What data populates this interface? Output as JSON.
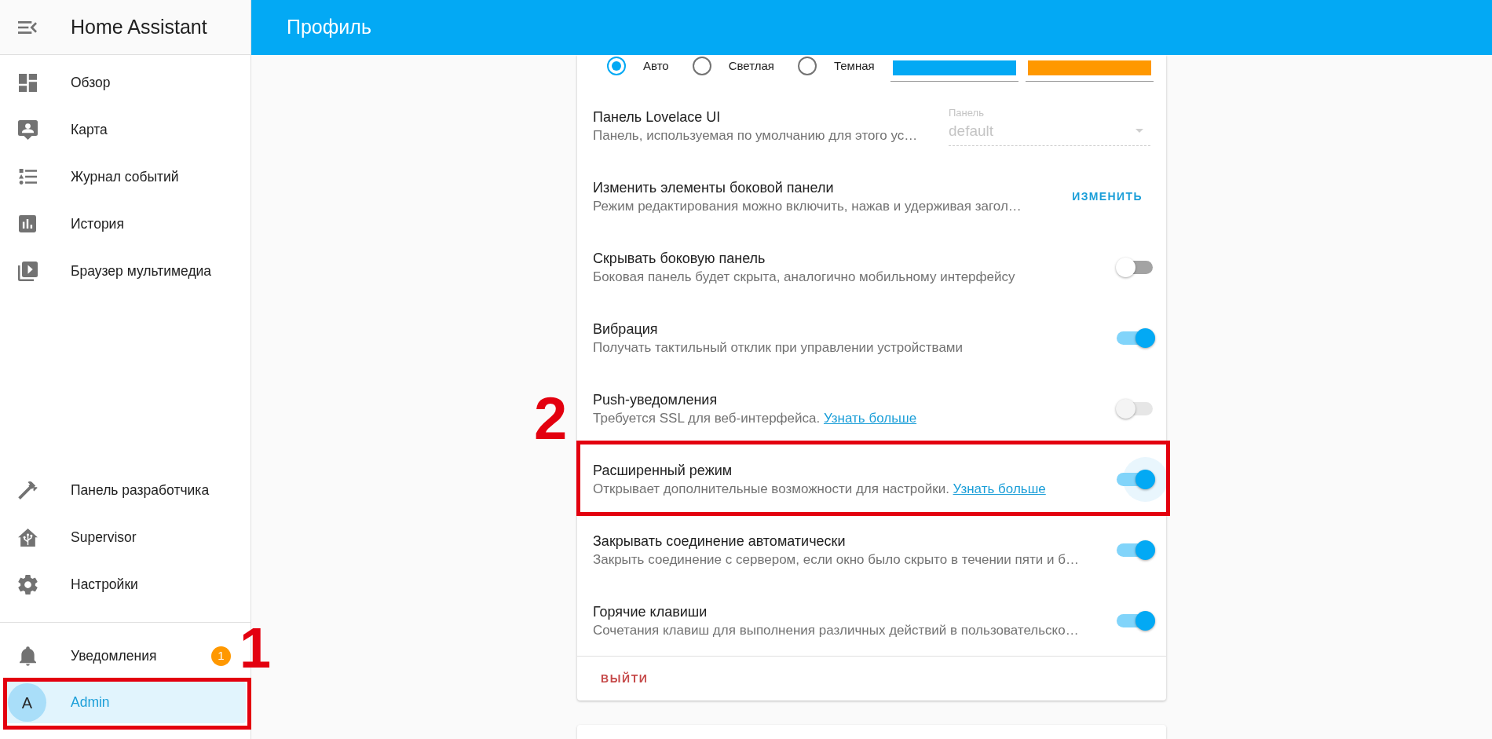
{
  "sidebar": {
    "title": "Home Assistant",
    "items": [
      {
        "label": "Обзор",
        "selected": false
      },
      {
        "label": "Карта",
        "selected": false
      },
      {
        "label": "Журнал событий",
        "selected": false
      },
      {
        "label": "История",
        "selected": false
      },
      {
        "label": "Браузер мультимедиа",
        "selected": false
      }
    ],
    "bottom_items": [
      {
        "label": "Панель разработчика",
        "selected": false
      },
      {
        "label": "Supervisor",
        "selected": false
      },
      {
        "label": "Настройки",
        "selected": false
      }
    ],
    "notifications": {
      "label": "Уведомления",
      "badge": "1"
    },
    "user": {
      "initial": "A",
      "name": "Admin",
      "selected": true,
      "callout": "1"
    }
  },
  "header": {
    "title": "Профиль"
  },
  "theme": {
    "options": [
      {
        "label": "Авто",
        "selected": true
      },
      {
        "label": "Светлая",
        "selected": false
      },
      {
        "label": "Темная",
        "selected": false
      }
    ],
    "colors": [
      {
        "color": "#03a9f4"
      },
      {
        "color": "#ff9800"
      }
    ]
  },
  "settings": [
    {
      "kind": "select",
      "title": "Панель Lovelace UI",
      "description": "Панель, используемая по умолчанию для этого ус…",
      "select": {
        "label": "Панель",
        "value": "default",
        "disabled": true
      }
    },
    {
      "kind": "button",
      "title": "Изменить элементы боковой панели",
      "description": "Режим редактирования можно включить, нажав и удерживая загол…",
      "button": "ИЗМЕНИТЬ"
    },
    {
      "kind": "toggle",
      "title": "Скрывать боковую панель",
      "description": "Боковая панель будет скрыта, аналогично мобильному интерфейсу",
      "on": false,
      "disabled": false,
      "focused": false
    },
    {
      "kind": "toggle",
      "title": "Вибрация",
      "description": "Получать тактильный отклик при управлении устройствами",
      "on": true,
      "disabled": false,
      "focused": false
    },
    {
      "kind": "toggle",
      "title": "Push-уведомления",
      "description": "Требуется SSL для веб-интерфейса.",
      "link": "Узнать больше",
      "on": false,
      "disabled": true,
      "focused": false
    },
    {
      "kind": "toggle",
      "title": "Расширенный режим",
      "description": "Открывает дополнительные возможности для настройки.",
      "link": "Узнать больше",
      "on": true,
      "disabled": false,
      "focused": true,
      "callout": "2"
    },
    {
      "kind": "toggle",
      "title": "Закрывать соединение автоматически",
      "description": "Закрыть соединение с сервером, если окно было скрыто в течении пяти и б…",
      "on": true,
      "disabled": false,
      "focused": false
    },
    {
      "kind": "toggle",
      "title": "Горячие клавиши",
      "description": "Сочетания клавиш для выполнения различных действий в пользовательско…",
      "on": true,
      "disabled": false,
      "focused": false
    }
  ],
  "logout": {
    "label": "ВЫЙТИ"
  }
}
